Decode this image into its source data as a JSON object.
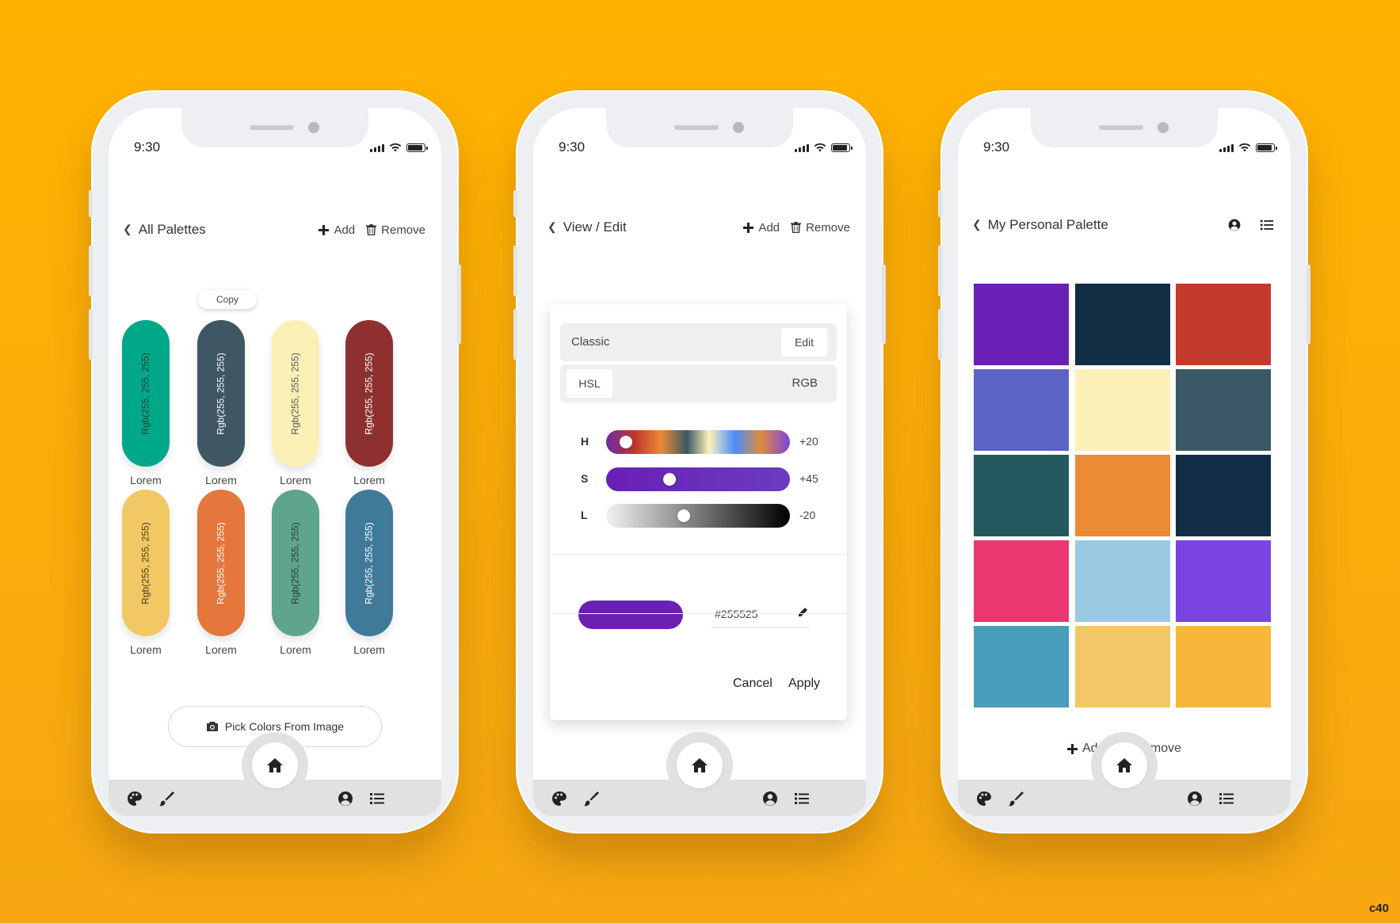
{
  "status_time": "9:30",
  "screen1": {
    "back_label": "All Palettes",
    "add_label": "Add",
    "remove_label": "Remove",
    "copy_tooltip": "Copy",
    "pills": [
      {
        "color": "#00A88A",
        "text": "Rgb(255, 255, 255)",
        "text_color": "#1f3d35",
        "label": "Lorem"
      },
      {
        "color": "#3E5763",
        "text": "Rgb(255, 255, 255)",
        "text_color": "#ffffff",
        "label": "Lorem"
      },
      {
        "color": "#FDF0B7",
        "text": "Rgb(255, 255, 255)",
        "text_color": "#555555",
        "label": "Lorem"
      },
      {
        "color": "#8E3030",
        "text": "Rgb(255, 255, 255)",
        "text_color": "#ffffff",
        "label": "Lorem"
      },
      {
        "color": "#F2C865",
        "text": "Rgb(255, 255, 255)",
        "text_color": "#4a3a12",
        "label": "Lorem"
      },
      {
        "color": "#E5773D",
        "text": "Rgb(255, 255, 255)",
        "text_color": "#ffffff",
        "label": "Lorem"
      },
      {
        "color": "#5EA58C",
        "text": "Rgb(255, 255, 255)",
        "text_color": "#1f3d35",
        "label": "Lorem"
      },
      {
        "color": "#3F7A9A",
        "text": "Rgb(255, 255, 255)",
        "text_color": "#ffffff",
        "label": "Lorem"
      }
    ],
    "pick_button": "Pick Colors From Image"
  },
  "screen2": {
    "back_label": "View / Edit",
    "add_label": "Add",
    "remove_label": "Remove",
    "classic_label": "Classic",
    "edit_label": "Edit",
    "hsl_label": "HSL",
    "rgb_label": "RGB",
    "sliders": [
      {
        "key": "H",
        "value": "+20",
        "knob_pct": 0.05
      },
      {
        "key": "S",
        "value": "+45",
        "knob_pct": 0.32
      },
      {
        "key": "L",
        "value": "-20",
        "knob_pct": 0.41
      }
    ],
    "swatch_color": "#6A1FB5",
    "hex_value": "#255525",
    "cancel_label": "Cancel",
    "apply_label": "Apply"
  },
  "screen3": {
    "back_label": "My Personal Palette",
    "tiles": [
      "#6A1FB5",
      "#112E44",
      "#C53A2F",
      "#5C63C6",
      "#FDF1B9",
      "#3A5866",
      "#245960",
      "#EC8A35",
      "#122E46",
      "#EC3670",
      "#9ACAE3",
      "#7A44E0",
      "#4A9DBC",
      "#F2C767",
      "#F6B73A"
    ],
    "add_label": "Add",
    "remove_label": "Remove"
  },
  "corner_mark": "c40"
}
